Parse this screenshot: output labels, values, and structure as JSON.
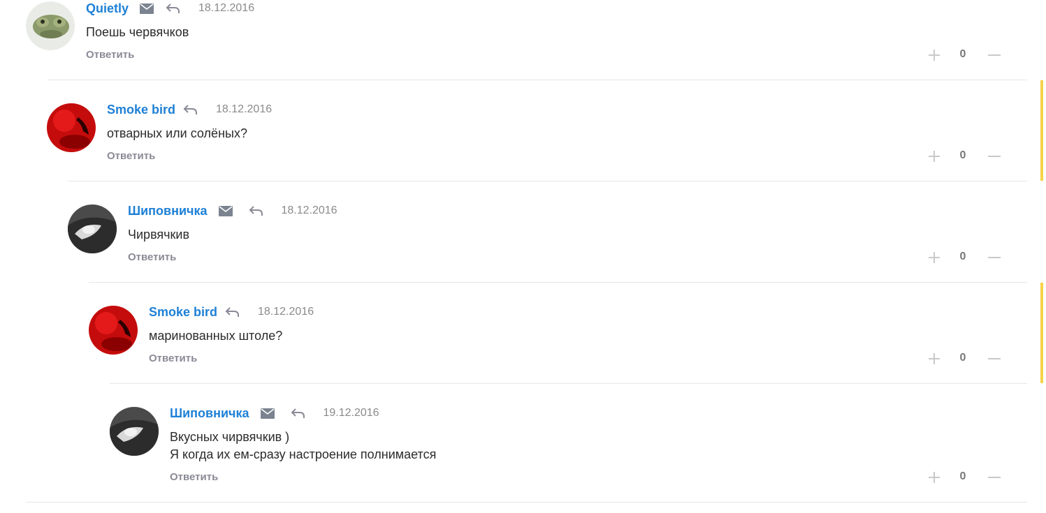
{
  "comments": [
    {
      "author": "Quietly",
      "date": "18.12.2016",
      "text": [
        "Поешь червячков"
      ],
      "reply_label": "Ответить",
      "score": "0",
      "has_mail": true,
      "avatar": "frog"
    },
    {
      "author": "Smoke bird",
      "date": "18.12.2016",
      "text": [
        "отварных или солёных?"
      ],
      "reply_label": "Ответить",
      "score": "0",
      "has_mail": false,
      "avatar": "red"
    },
    {
      "author": "Шиповничка",
      "date": "18.12.2016",
      "text": [
        "Чирвячкив"
      ],
      "reply_label": "Ответить",
      "score": "0",
      "has_mail": true,
      "avatar": "bw"
    },
    {
      "author": "Smoke bird",
      "date": "18.12.2016",
      "text": [
        "маринованных штоле?"
      ],
      "reply_label": "Ответить",
      "score": "0",
      "has_mail": false,
      "avatar": "red"
    },
    {
      "author": "Шиповничка",
      "date": "19.12.2016",
      "text": [
        "Вкусных чирвячкив )",
        "Я когда их ем-сразу настроение полнимается"
      ],
      "reply_label": "Ответить",
      "score": "0",
      "has_mail": true,
      "avatar": "bw"
    }
  ],
  "colors": {
    "author": "#1e80d6",
    "highlight": "#f5d24a",
    "separator": "#e6e6e6"
  }
}
